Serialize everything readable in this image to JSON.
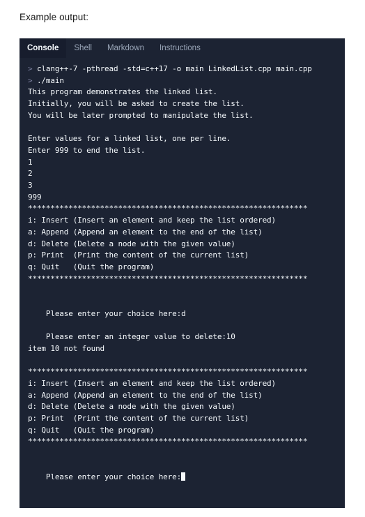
{
  "page": {
    "heading": "Example output:"
  },
  "console": {
    "tabs": [
      {
        "label": "Console",
        "active": true
      },
      {
        "label": "Shell",
        "active": false
      },
      {
        "label": "Markdown",
        "active": false
      },
      {
        "label": "Instructions",
        "active": false
      }
    ],
    "colors": {
      "panel_background": "#1c2333",
      "active_tab_background": "#171d2d",
      "text": "#f5f9fc",
      "prompt_chevron": "#7b7f9e",
      "inactive_tab_text": "#9aa6b8"
    },
    "prompt_symbol": ">",
    "separator": "**************************************************************",
    "lines": [
      {
        "type": "command",
        "text": "clang++-7 -pthread -std=c++17 -o main LinkedList.cpp main.cpp"
      },
      {
        "type": "command",
        "text": "./main"
      },
      {
        "type": "output",
        "text": "This program demonstrates the linked list."
      },
      {
        "type": "output",
        "text": "Initially, you will be asked to create the list."
      },
      {
        "type": "output",
        "text": "You will be later prompted to manipulate the list."
      },
      {
        "type": "blank",
        "text": ""
      },
      {
        "type": "output",
        "text": "Enter values for a linked list, one per line."
      },
      {
        "type": "output",
        "text": "Enter 999 to end the list."
      },
      {
        "type": "output",
        "text": "1"
      },
      {
        "type": "output",
        "text": "2"
      },
      {
        "type": "output",
        "text": "3"
      },
      {
        "type": "output",
        "text": "999"
      },
      {
        "type": "separator",
        "text": "**************************************************************"
      },
      {
        "type": "output",
        "text": "i: Insert (Insert an element and keep the list ordered)"
      },
      {
        "type": "output",
        "text": "a: Append (Append an element to the end of the list)"
      },
      {
        "type": "output",
        "text": "d: Delete (Delete a node with the given value)"
      },
      {
        "type": "output",
        "text": "p: Print  (Print the content of the current list)"
      },
      {
        "type": "output",
        "text": "q: Quit   (Quit the program)"
      },
      {
        "type": "separator",
        "text": "**************************************************************"
      },
      {
        "type": "blank",
        "text": ""
      },
      {
        "type": "blank",
        "text": ""
      },
      {
        "type": "output",
        "text": "    Please enter your choice here:d"
      },
      {
        "type": "blank",
        "text": ""
      },
      {
        "type": "output",
        "text": "    Please enter an integer value to delete:10"
      },
      {
        "type": "output",
        "text": "item 10 not found"
      },
      {
        "type": "blank",
        "text": ""
      },
      {
        "type": "separator",
        "text": "**************************************************************"
      },
      {
        "type": "output",
        "text": "i: Insert (Insert an element and keep the list ordered)"
      },
      {
        "type": "output",
        "text": "a: Append (Append an element to the end of the list)"
      },
      {
        "type": "output",
        "text": "d: Delete (Delete a node with the given value)"
      },
      {
        "type": "output",
        "text": "p: Print  (Print the content of the current list)"
      },
      {
        "type": "output",
        "text": "q: Quit   (Quit the program)"
      },
      {
        "type": "separator",
        "text": "**************************************************************"
      },
      {
        "type": "blank",
        "text": ""
      },
      {
        "type": "blank",
        "text": ""
      },
      {
        "type": "cursor-line",
        "text": "    Please enter your choice here:"
      }
    ]
  }
}
